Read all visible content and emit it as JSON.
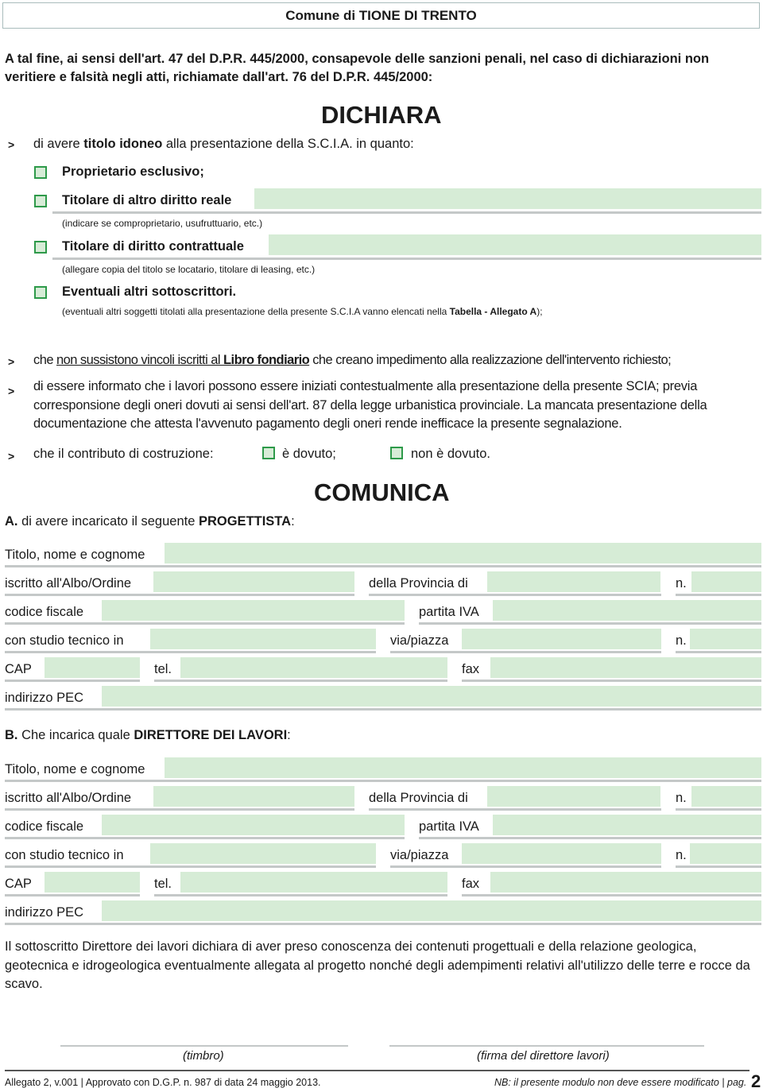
{
  "header": {
    "title": "Comune di TIONE DI TRENTO"
  },
  "intro": "A tal fine, ai sensi dell'art. 47 del D.P.R. 445/2000, consapevole delle sanzioni penali, nel caso di dichiarazioni non veritiere e falsità negli atti, richiamate dall'art. 76 del D.P.R. 445/2000:",
  "dichiara": {
    "heading": "DICHIARA",
    "bullet": ">",
    "titolo": {
      "pre": "di avere ",
      "bold": "titolo idoneo",
      "post": " alla presentazione della S.C.I.A. in quanto:"
    },
    "options": [
      {
        "label": "Proprietario esclusivo;",
        "checked": false
      },
      {
        "label": "Titolare di altro diritto reale",
        "note": "(indicare se comproprietario, usufruttuario, etc.)",
        "value": "",
        "checked": false
      },
      {
        "label": "Titolare di diritto contrattuale",
        "note": "(allegare copia del titolo se locatario, titolare di leasing, etc.)",
        "value": "",
        "checked": false
      },
      {
        "label": "Eventuali altri sottoscrittori.",
        "note_pre": "(eventuali altri soggetti titolati alla presentazione della presente S.C.I.A vanno elencati nella ",
        "note_bold": "Tabella - Allegato A",
        "note_post": ");",
        "checked": false
      }
    ],
    "vincoli": {
      "pre": "che ",
      "u1": "non sussistono vincoli iscritti al ",
      "ub": "Libro fondiario",
      "post": " che creano impedimento alla realizzazione dell'intervento richiesto;"
    },
    "informato": "di essere informato che i lavori possono essere iniziati contestualmente alla presentazione della presente SCIA; previa corresponsione degli oneri dovuti ai sensi dell'art. 87 della legge urbanistica provinciale. La mancata presentazione della documentazione che attesta l'avvenuto pagamento degli oneri rende inefficace la presente segnalazione.",
    "contributo": {
      "label": "che il contributo di costruzione:",
      "opt1": "è dovuto;",
      "opt2": "non è dovuto.",
      "opt1_checked": false,
      "opt2_checked": false
    }
  },
  "comunica": {
    "heading": "COMUNICA",
    "sectionA": {
      "letter": "A.",
      "pre": " di avere incaricato il seguente ",
      "bold": "PROGETTISTA",
      "post": ":"
    },
    "sectionB": {
      "letter": "B.",
      "pre": " Che incarica quale ",
      "bold": "DIRETTORE DEI LAVORI",
      "post": ":"
    },
    "labels": {
      "titolo": "Titolo, nome e cognome",
      "albo": "iscritto all'Albo/Ordine",
      "provincia": "della Provincia di",
      "n": "n.",
      "cf": "codice fiscale",
      "piva": "partita IVA",
      "studio": "con studio tecnico in",
      "via": "via/piazza",
      "cap": "CAP",
      "tel": "tel.",
      "fax": "fax",
      "pec": "indirizzo PEC"
    },
    "progettista": {
      "titolo": "",
      "albo": "",
      "provincia": "",
      "n_albo": "",
      "cf": "",
      "piva": "",
      "studio": "",
      "via": "",
      "n_civico": "",
      "cap": "",
      "tel": "",
      "fax": "",
      "pec": ""
    },
    "direttore": {
      "titolo": "",
      "albo": "",
      "provincia": "",
      "n_albo": "",
      "cf": "",
      "piva": "",
      "studio": "",
      "via": "",
      "n_civico": "",
      "cap": "",
      "tel": "",
      "fax": "",
      "pec": ""
    }
  },
  "dichiarazione_direttore": "Il sottoscritto Direttore dei lavori dichiara di aver preso conoscenza dei contenuti progettuali e della relazione geologica, geotecnica e idrogeologica eventualmente allegata al progetto nonché degli adempimenti relativi all'utilizzo delle terre e rocce da scavo.",
  "signatures": {
    "timbro": "(timbro)",
    "firma": "(firma del direttore lavori)"
  },
  "footer": {
    "left": "Allegato 2, v.001 | Approvato con D.G.P. n. 987 di data 24 maggio 2013.",
    "right": "NB: il presente modulo non deve essere modificato | pag.",
    "page": "2"
  }
}
